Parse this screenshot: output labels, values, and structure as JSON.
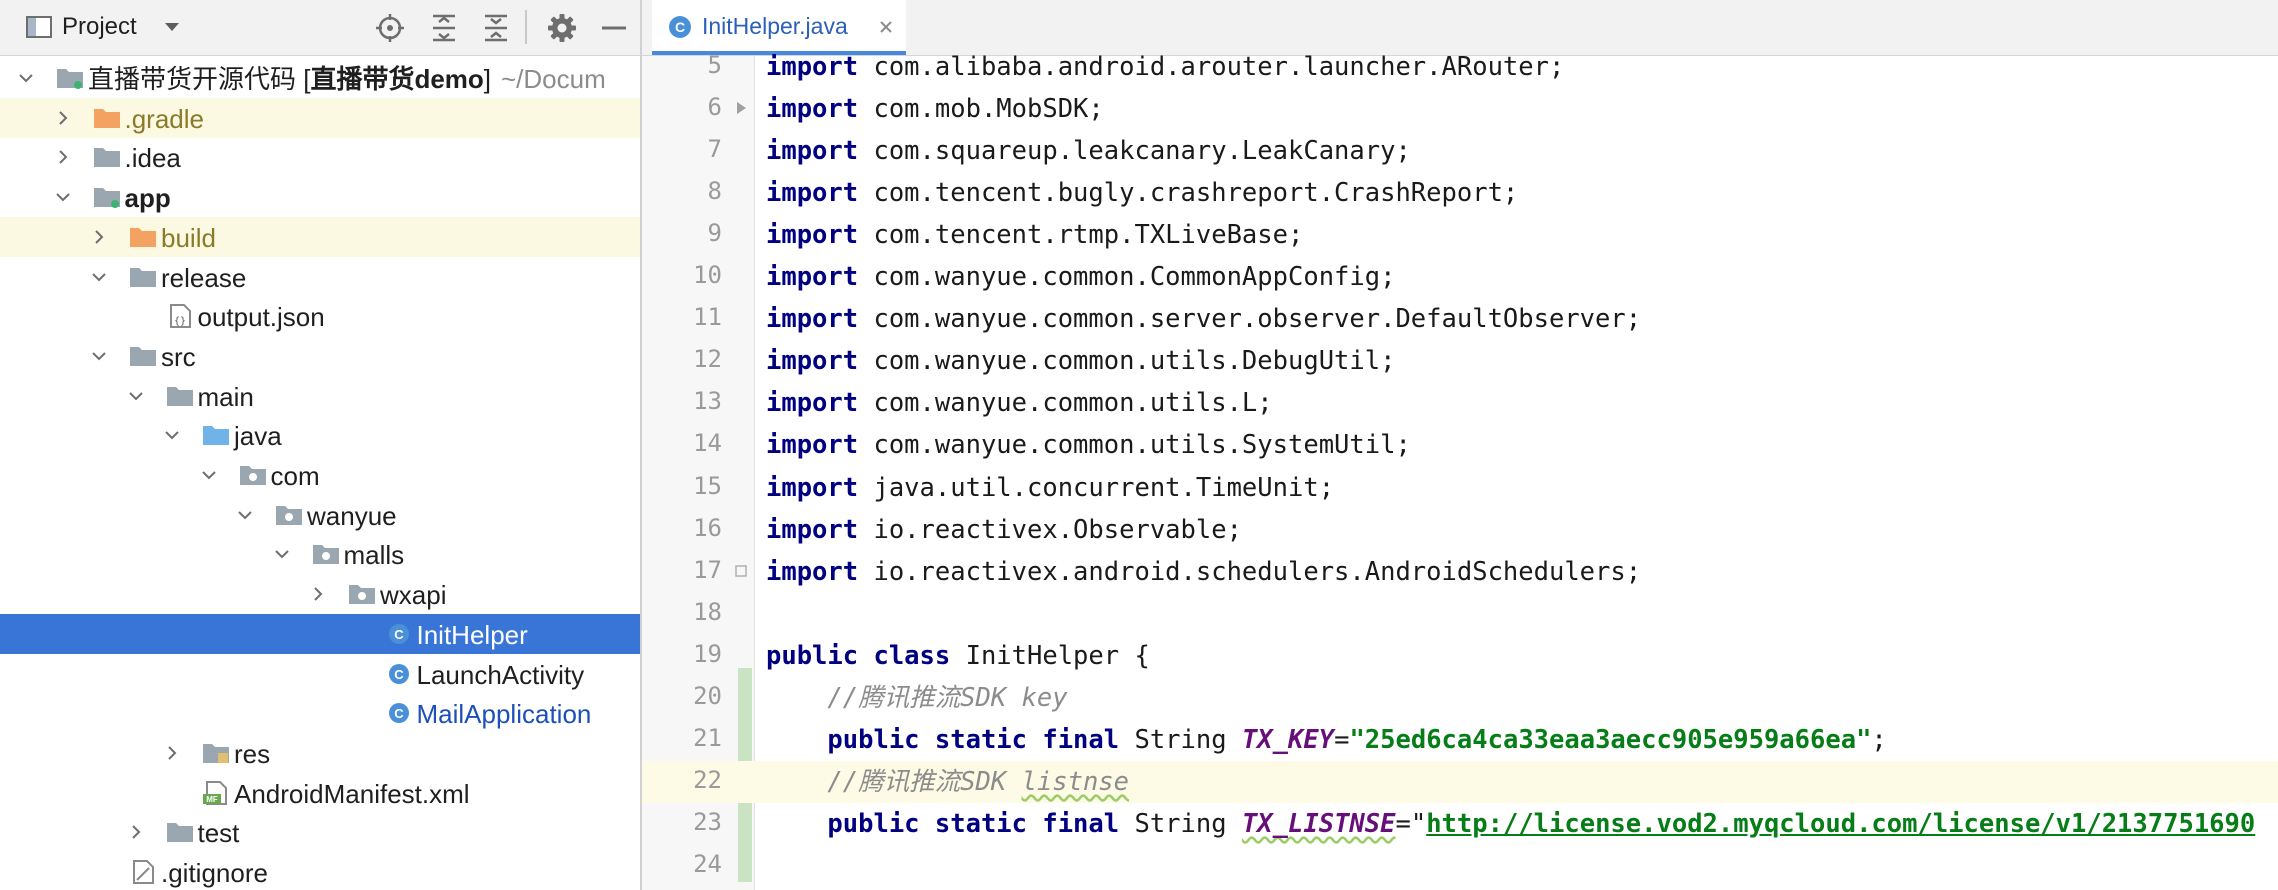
{
  "panel": {
    "title": "Project"
  },
  "tree": [
    {
      "depth": 0,
      "arrow": "down",
      "icon": "module-folder",
      "label": "直播带货开源代码 [",
      "label_bold": "直播带货demo",
      "label_end": "]",
      "path": "~/Docum"
    },
    {
      "depth": 1,
      "arrow": "right",
      "icon": "folder-orange",
      "label": ".gradle",
      "style": "excluded",
      "highlight": true
    },
    {
      "depth": 1,
      "arrow": "right",
      "icon": "folder-grey",
      "label": ".idea"
    },
    {
      "depth": 1,
      "arrow": "down",
      "icon": "module-folder",
      "label": "app",
      "bold": true
    },
    {
      "depth": 2,
      "arrow": "right",
      "icon": "folder-orange",
      "label": "build",
      "style": "excluded",
      "highlight": true
    },
    {
      "depth": 2,
      "arrow": "down",
      "icon": "folder-grey",
      "label": "release"
    },
    {
      "depth": 3,
      "arrow": "none",
      "icon": "json-file",
      "label": "output.json"
    },
    {
      "depth": 2,
      "arrow": "down",
      "icon": "folder-grey",
      "label": "src"
    },
    {
      "depth": 3,
      "arrow": "down",
      "icon": "folder-grey",
      "label": "main"
    },
    {
      "depth": 4,
      "arrow": "down",
      "icon": "folder-blue",
      "label": "java"
    },
    {
      "depth": 5,
      "arrow": "down",
      "icon": "package-folder",
      "label": "com"
    },
    {
      "depth": 6,
      "arrow": "down",
      "icon": "package-folder",
      "label": "wanyue"
    },
    {
      "depth": 7,
      "arrow": "down",
      "icon": "package-folder",
      "label": "malls"
    },
    {
      "depth": 8,
      "arrow": "right",
      "icon": "package-folder",
      "label": "wxapi"
    },
    {
      "depth": 9,
      "arrow": "none",
      "icon": "class-file",
      "label": "InitHelper",
      "selected": true
    },
    {
      "depth": 9,
      "arrow": "none",
      "icon": "class-file",
      "label": "LaunchActivity"
    },
    {
      "depth": 9,
      "arrow": "none",
      "icon": "class-file",
      "label": "MailApplication",
      "style": "link"
    },
    {
      "depth": 4,
      "arrow": "right",
      "icon": "res-folder",
      "label": "res"
    },
    {
      "depth": 4,
      "arrow": "none",
      "icon": "manifest-file",
      "label": "AndroidManifest.xml"
    },
    {
      "depth": 3,
      "arrow": "right",
      "icon": "folder-grey",
      "label": "test"
    },
    {
      "depth": 2,
      "arrow": "none",
      "icon": "gitignore-file",
      "label": ".gitignore"
    }
  ],
  "editor": {
    "tab_label": "InitHelper.java",
    "current_line": 22,
    "lines": [
      {
        "n": "5",
        "tokens": [
          [
            "kw",
            "import"
          ],
          [
            "",
            "com.alibaba.android.arouter.launcher.ARouter;"
          ]
        ]
      },
      {
        "n": "6",
        "tokens": [
          [
            "kw",
            "import"
          ],
          [
            "",
            "com.mob.MobSDK;"
          ]
        ],
        "fold": "open"
      },
      {
        "n": "7",
        "tokens": [
          [
            "kw",
            "import"
          ],
          [
            "",
            "com.squareup.leakcanary.LeakCanary;"
          ]
        ]
      },
      {
        "n": "8",
        "tokens": [
          [
            "kw",
            "import"
          ],
          [
            "",
            "com.tencent.bugly.crashreport.CrashReport;"
          ]
        ]
      },
      {
        "n": "9",
        "tokens": [
          [
            "kw",
            "import"
          ],
          [
            "",
            "com.tencent.rtmp.TXLiveBase;"
          ]
        ]
      },
      {
        "n": "10",
        "tokens": [
          [
            "kw",
            "import"
          ],
          [
            "",
            "com.wanyue.common.CommonAppConfig;"
          ]
        ]
      },
      {
        "n": "11",
        "tokens": [
          [
            "kw",
            "import"
          ],
          [
            "",
            "com.wanyue.common.server.observer.DefaultObserver;"
          ]
        ]
      },
      {
        "n": "12",
        "tokens": [
          [
            "kw",
            "import"
          ],
          [
            "",
            "com.wanyue.common.utils.DebugUtil;"
          ]
        ]
      },
      {
        "n": "13",
        "tokens": [
          [
            "kw",
            "import"
          ],
          [
            "",
            "com.wanyue.common.utils.L;"
          ]
        ]
      },
      {
        "n": "14",
        "tokens": [
          [
            "kw",
            "import"
          ],
          [
            "",
            "com.wanyue.common.utils.SystemUtil;"
          ]
        ]
      },
      {
        "n": "15",
        "tokens": [
          [
            "kw",
            "import"
          ],
          [
            "",
            "java.util.concurrent.TimeUnit;"
          ]
        ]
      },
      {
        "n": "16",
        "tokens": [
          [
            "kw",
            "import"
          ],
          [
            "",
            "io.reactivex.Observable;"
          ]
        ]
      },
      {
        "n": "17",
        "tokens": [
          [
            "kw",
            "import"
          ],
          [
            "",
            "io.reactivex.android.schedulers.AndroidSchedulers;"
          ]
        ],
        "fold": "close"
      },
      {
        "n": "18",
        "tokens": []
      },
      {
        "n": "19",
        "tokens": [
          [
            "kw",
            "public class"
          ],
          [
            "",
            " InitHelper {"
          ]
        ]
      },
      {
        "n": "20",
        "tokens": [
          [
            "",
            "    "
          ],
          [
            "cm",
            "//腾讯推流SDK key"
          ]
        ]
      },
      {
        "n": "21",
        "tokens": [
          [
            "",
            "    "
          ],
          [
            "kw",
            "public static final"
          ],
          [
            "",
            " String "
          ],
          [
            "fld",
            "TX_KEY"
          ],
          [
            "",
            "="
          ],
          [
            "str",
            "\"25ed6ca4ca33eaa3aecc905e959a66ea\""
          ],
          [
            "",
            ";"
          ]
        ]
      },
      {
        "n": "22",
        "tokens": [
          [
            "",
            "    "
          ],
          [
            "cm",
            "//腾讯推流SDK "
          ],
          [
            "cm squig",
            "listnse"
          ]
        ]
      },
      {
        "n": "23",
        "tokens": [
          [
            "",
            "    "
          ],
          [
            "kw",
            "public static final"
          ],
          [
            "",
            " String "
          ],
          [
            "fld squig",
            "TX_LISTNSE"
          ],
          [
            "",
            "=\""
          ],
          [
            "url",
            "http://license.vod2.myqcloud.com/license/v1/2137751690"
          ]
        ]
      },
      {
        "n": "24",
        "tokens": []
      }
    ]
  },
  "colors": {
    "selection": "#3875d7",
    "excluded_highlight": "#fcf9e3",
    "keyword": "#000080",
    "string": "#067d17",
    "field": "#660e7a",
    "comment": "#8c8c8c",
    "vcs_added": "#c9e3c3"
  }
}
